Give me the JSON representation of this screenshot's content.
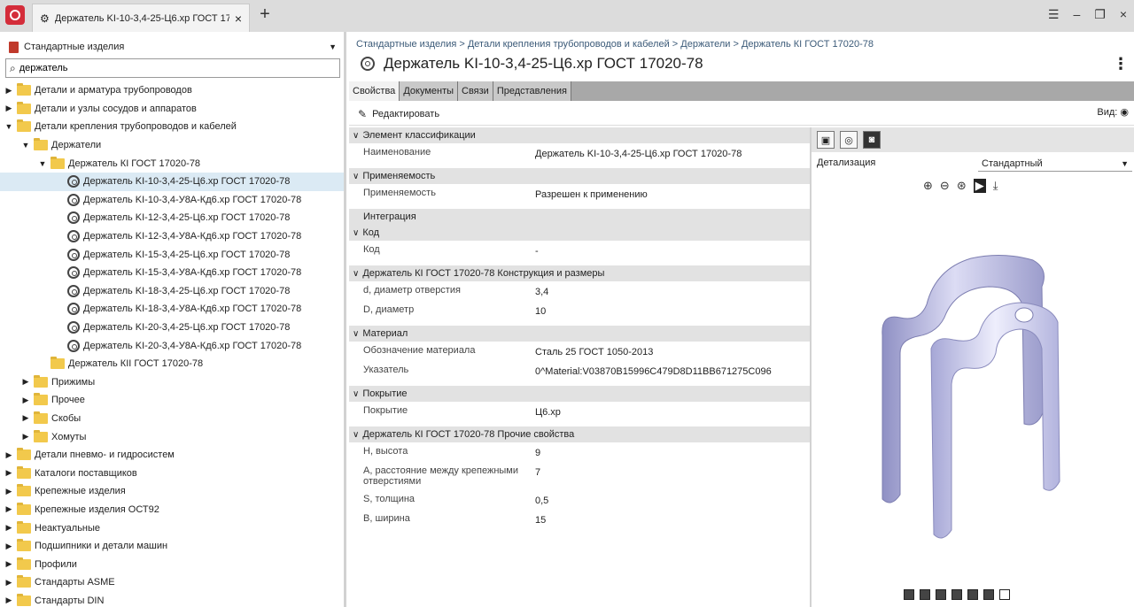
{
  "tab": {
    "title": "Держатель KI-10-3,4-25-Ц6.хр ГОСТ 17...",
    "close": "×",
    "new": "+"
  },
  "window": {
    "menu": "☰",
    "minimize": "‒",
    "restore": "❐",
    "close": "×"
  },
  "left": {
    "catalog": "Стандартные изделия",
    "search_value": "держатель",
    "tree": [
      {
        "label": "Детали и арматура трубопроводов",
        "level": 0,
        "kind": "folder",
        "twist": "collapsed"
      },
      {
        "label": "Детали и узлы сосудов и аппаратов",
        "level": 0,
        "kind": "folder",
        "twist": "collapsed"
      },
      {
        "label": "Детали крепления трубопроводов и кабелей",
        "level": 0,
        "kind": "folder",
        "twist": "expanded"
      },
      {
        "label": "Держатели",
        "level": 1,
        "kind": "folder",
        "twist": "expanded"
      },
      {
        "label": "Держатель КI ГОСТ 17020-78",
        "level": 2,
        "kind": "folder",
        "twist": "expanded"
      },
      {
        "label": "Держатель KI-10-3,4-25-Ц6.хр ГОСТ 17020-78",
        "level": 3,
        "kind": "part",
        "twist": "none",
        "selected": true
      },
      {
        "label": "Держатель KI-10-3,4-У8А-Кд6.хр ГОСТ 17020-78",
        "level": 3,
        "kind": "part",
        "twist": "none"
      },
      {
        "label": "Держатель KI-12-3,4-25-Ц6.хр ГОСТ 17020-78",
        "level": 3,
        "kind": "part",
        "twist": "none"
      },
      {
        "label": "Держатель KI-12-3,4-У8А-Кд6.хр ГОСТ 17020-78",
        "level": 3,
        "kind": "part",
        "twist": "none"
      },
      {
        "label": "Держатель KI-15-3,4-25-Ц6.хр ГОСТ 17020-78",
        "level": 3,
        "kind": "part",
        "twist": "none"
      },
      {
        "label": "Держатель KI-15-3,4-У8А-Кд6.хр ГОСТ 17020-78",
        "level": 3,
        "kind": "part",
        "twist": "none"
      },
      {
        "label": "Держатель KI-18-3,4-25-Ц6.хр ГОСТ 17020-78",
        "level": 3,
        "kind": "part",
        "twist": "none"
      },
      {
        "label": "Держатель KI-18-3,4-У8А-Кд6.хр ГОСТ 17020-78",
        "level": 3,
        "kind": "part",
        "twist": "none"
      },
      {
        "label": "Держатель KI-20-3,4-25-Ц6.хр ГОСТ 17020-78",
        "level": 3,
        "kind": "part",
        "twist": "none"
      },
      {
        "label": "Держатель KI-20-3,4-У8А-Кд6.хр ГОСТ 17020-78",
        "level": 3,
        "kind": "part",
        "twist": "none"
      },
      {
        "label": "Держатель КII ГОСТ 17020-78",
        "level": 2,
        "kind": "folder",
        "twist": "none"
      },
      {
        "label": "Прижимы",
        "level": 1,
        "kind": "folder",
        "twist": "collapsed"
      },
      {
        "label": "Прочее",
        "level": 1,
        "kind": "folder",
        "twist": "collapsed"
      },
      {
        "label": "Скобы",
        "level": 1,
        "kind": "folder",
        "twist": "collapsed"
      },
      {
        "label": "Хомуты",
        "level": 1,
        "kind": "folder",
        "twist": "collapsed"
      },
      {
        "label": "Детали пневмо- и гидросистем",
        "level": 0,
        "kind": "folder",
        "twist": "collapsed"
      },
      {
        "label": "Каталоги поставщиков",
        "level": 0,
        "kind": "folder",
        "twist": "collapsed"
      },
      {
        "label": "Крепежные изделия",
        "level": 0,
        "kind": "folder",
        "twist": "collapsed"
      },
      {
        "label": "Крепежные изделия ОСТ92",
        "level": 0,
        "kind": "folder",
        "twist": "collapsed"
      },
      {
        "label": "Неактуальные",
        "level": 0,
        "kind": "folder",
        "twist": "collapsed"
      },
      {
        "label": "Подшипники и детали машин",
        "level": 0,
        "kind": "folder",
        "twist": "collapsed"
      },
      {
        "label": "Профили",
        "level": 0,
        "kind": "folder",
        "twist": "collapsed"
      },
      {
        "label": "Стандарты ASME",
        "level": 0,
        "kind": "folder",
        "twist": "collapsed"
      },
      {
        "label": "Стандарты DIN",
        "level": 0,
        "kind": "folder",
        "twist": "collapsed"
      }
    ]
  },
  "main": {
    "breadcrumb": "Стандартные изделия > Детали крепления трубопроводов и кабелей > Держатели > Держатель КI ГОСТ 17020-78",
    "title": "Держатель KI-10-3,4-25-Ц6.хр ГОСТ 17020-78",
    "kebab": "⋮",
    "tabs": [
      "Свойства",
      "Документы",
      "Связи",
      "Представления"
    ],
    "edit_label": "Редактировать",
    "view_label": "Вид:",
    "groups": [
      {
        "title": "Элемент классификации",
        "chevron": "∨",
        "rows": [
          {
            "name": "Наименование",
            "value": "Держатель KI-10-3,4-25-Ц6.хр ГОСТ 17020-78"
          }
        ]
      },
      {
        "title": "Применяемость",
        "chevron": "∨",
        "rows": [
          {
            "name": "Применяемость",
            "value": "Разрешен к применению"
          }
        ]
      },
      {
        "title": "Интеграция",
        "chevron": "",
        "rows": []
      },
      {
        "title": "Код",
        "chevron": "∨",
        "rows": [
          {
            "name": "Код",
            "value": "-"
          }
        ]
      },
      {
        "title": "Держатель КI ГОСТ 17020-78 Конструкция и размеры",
        "chevron": "∨",
        "rows": [
          {
            "name": "d, диаметр отверстия",
            "value": "3,4"
          },
          {
            "name": "D, диаметр",
            "value": "10"
          }
        ]
      },
      {
        "title": "Материал",
        "chevron": "∨",
        "rows": [
          {
            "name": "Обозначение материала",
            "value": "Сталь 25 ГОСТ 1050-2013"
          },
          {
            "name": "Указатель",
            "value": "0^Material:V03870B15996C479D8D11BB671275C096"
          }
        ]
      },
      {
        "title": "Покрытие",
        "chevron": "∨",
        "rows": [
          {
            "name": "Покрытие",
            "value": "Ц6.хр"
          }
        ]
      },
      {
        "title": "Держатель КI ГОСТ 17020-78 Прочие свойства",
        "chevron": "∨",
        "rows": [
          {
            "name": "H, высота",
            "value": "9"
          },
          {
            "name": "A, расстояние между крепежными отверстиями",
            "value": "7"
          },
          {
            "name": "S, толщина",
            "value": "0,5"
          },
          {
            "name": "B, ширина",
            "value": "15"
          }
        ]
      }
    ]
  },
  "viewer": {
    "detail_label": "Детализация",
    "detail_value": "Стандартный"
  }
}
